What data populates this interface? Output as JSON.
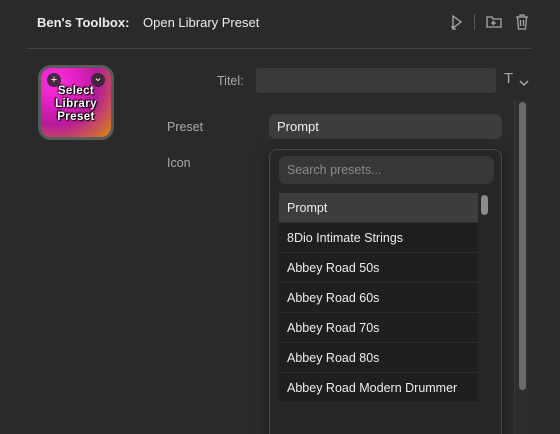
{
  "header": {
    "app_name": "Ben's Toolbox:",
    "action_title": "Open Library Preset",
    "icons": [
      "run-icon",
      "folder-icon",
      "trash-icon"
    ]
  },
  "preset_icon": {
    "text": "Select\nLibrary\nPreset",
    "add_badge": "+",
    "menu_badge": "⌄",
    "colors": {
      "primary": "#e020c0",
      "secondary": "#d88a10"
    }
  },
  "form": {
    "titel_label": "Titel:",
    "titel_value": "",
    "text_button": "T",
    "preset_label": "Preset",
    "preset_value": "Prompt",
    "icon_label": "Icon"
  },
  "dropdown": {
    "search_placeholder": "Search presets...",
    "items": [
      "Prompt",
      "8Dio Intimate Strings",
      "Abbey Road 50s",
      "Abbey Road 60s",
      "Abbey Road 70s",
      "Abbey Road 80s",
      "Abbey Road Modern Drummer"
    ],
    "selected_index": 0
  },
  "colors": {
    "background": "#2a2a2a",
    "field": "#3a3a3a",
    "text": "#e6e6e6",
    "muted": "#a9a9a9"
  }
}
